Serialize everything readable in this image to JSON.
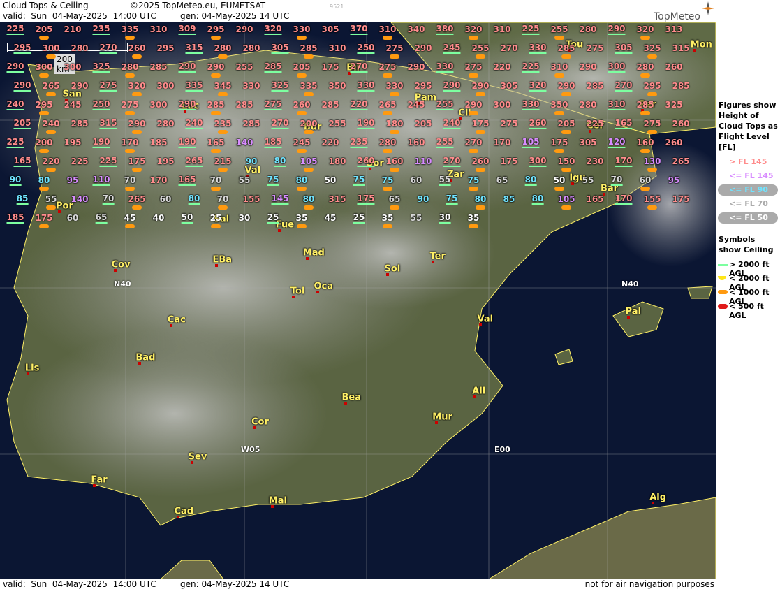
{
  "header": {
    "title": "Cloud Tops & Ceiling",
    "copyright": "©2025 TopMeteo.eu, EUMETSAT",
    "valid": "valid:  Sun  04-May-2025  14:00 UTC",
    "gen": "gen: 04-May-2025 14 UTC",
    "code": "9521",
    "brand": "TopMeteo"
  },
  "footer": {
    "valid": "valid:  Sun  04-May-2025  14:00 UTC",
    "gen": "gen: 04-May-2025 14 UTC",
    "note": "not for air navigation purposes"
  },
  "scale": {
    "label": "200 km"
  },
  "grid_labels": [
    "N40",
    "N40",
    "W05",
    "E00"
  ],
  "legend": {
    "figures_title": "Figures show Height of Cloud Tops as Flight Level  [FL]",
    "fl_items": [
      {
        "label": "> FL 145",
        "color": "#ff8c8c",
        "pill": false
      },
      {
        "label": "<= FL 145",
        "color": "#d88cff",
        "pill": false
      },
      {
        "label": "<= FL 90",
        "color": "#6fe4ff",
        "pill": true
      },
      {
        "label": "<= FL 70",
        "color": "#aaaaaa",
        "pill": false
      },
      {
        "label": "<= FL 50",
        "color": "#ffffff",
        "pill": true
      }
    ],
    "symbols_title": "Symbols show Ceiling",
    "symbol_items": [
      {
        "label": "> 2000 ft AGL",
        "symbol": "green-line"
      },
      {
        "label": "< 2000 ft AGL",
        "symbol": "yellow-half"
      },
      {
        "label": "< 1000 ft AGL",
        "symbol": "orange-bar"
      },
      {
        "label": "< 500 ft AGL",
        "symbol": "red-bar"
      }
    ]
  },
  "cities": [
    "Tou",
    "Mon",
    "Bil",
    "San",
    "Pam",
    "Luc",
    "Cil",
    "Per",
    "Cer",
    "Bur",
    "Sor",
    "Zar",
    "Val",
    "Igu",
    "Bar",
    "Por",
    "Sal",
    "Fue",
    "Mad",
    "EBa",
    "Cov",
    "Ter",
    "Sol",
    "Oca",
    "Tol",
    "Cac",
    "Val",
    "Pal",
    "Bad",
    "Lis",
    "Ali",
    "Bea",
    "Mur",
    "Cor",
    "Sev",
    "Far",
    "Cad",
    "Mal",
    "Alg"
  ],
  "cloud_top_values": [
    "225",
    "205",
    "210",
    "235",
    "335",
    "310",
    "309",
    "295",
    "290",
    "320",
    "330",
    "305",
    "370",
    "310",
    "340",
    "380",
    "320",
    "310",
    "225",
    "255",
    "280",
    "290",
    "320",
    "313",
    "295",
    "300",
    "280",
    "270",
    "260",
    "295",
    "315",
    "280",
    "280",
    "305",
    "285",
    "310",
    "250",
    "275",
    "290",
    "245",
    "255",
    "270",
    "330",
    "285",
    "275",
    "305",
    "325",
    "315",
    "290",
    "300",
    "300",
    "325",
    "280",
    "285",
    "290",
    "290",
    "255",
    "285",
    "205",
    "175",
    "270",
    "275",
    "290",
    "330",
    "275",
    "220",
    "225",
    "310",
    "290",
    "300",
    "280",
    "260",
    "290",
    "265",
    "290",
    "275",
    "320",
    "300",
    "335",
    "345",
    "330",
    "325",
    "335",
    "350",
    "330",
    "330",
    "295",
    "290",
    "290",
    "305",
    "320",
    "290",
    "285",
    "270",
    "295",
    "285",
    "240",
    "295",
    "245",
    "250",
    "275",
    "300",
    "290",
    "285",
    "285",
    "275",
    "260",
    "285",
    "220",
    "265",
    "245",
    "255",
    "290",
    "300",
    "330",
    "350",
    "280",
    "310",
    "285",
    "325",
    "205",
    "240",
    "285",
    "315",
    "290",
    "280",
    "240",
    "235",
    "285",
    "270",
    "200",
    "255",
    "190",
    "180",
    "205",
    "240",
    "175",
    "275",
    "260",
    "205",
    "225",
    "165",
    "275",
    "260",
    "225",
    "200",
    "195",
    "190",
    "170",
    "185",
    "190",
    "165",
    "140",
    "185",
    "245",
    "220",
    "235",
    "280",
    "160",
    "255",
    "270",
    "170",
    "105",
    "175",
    "305",
    "120",
    "160",
    "260",
    "165",
    "220",
    "225",
    "225",
    "175",
    "195",
    "265",
    "215",
    "90",
    "80",
    "105",
    "180",
    "260",
    "160",
    "110",
    "270",
    "260",
    "175",
    "300",
    "150",
    "230",
    "170",
    "130",
    "265",
    "90",
    "80",
    "95",
    "110",
    "70",
    "170",
    "165",
    "70",
    "55",
    "75",
    "80",
    "50",
    "75",
    "75",
    "60",
    "55",
    "75",
    "65",
    "80",
    "50",
    "55",
    "70",
    "60",
    "95",
    "85",
    "55",
    "140",
    "70",
    "265",
    "60",
    "80",
    "70",
    "155",
    "145",
    "80",
    "315",
    "175",
    "65",
    "90",
    "75",
    "80",
    "85",
    "80",
    "105",
    "165",
    "170",
    "155",
    "175",
    "185",
    "175",
    "60",
    "65",
    "45",
    "40",
    "50",
    "25",
    "30",
    "25",
    "35",
    "45",
    "25",
    "35",
    "55",
    "30",
    "35"
  ],
  "ceiling_symbols": [
    "red",
    "orange",
    "yellow",
    "green"
  ]
}
